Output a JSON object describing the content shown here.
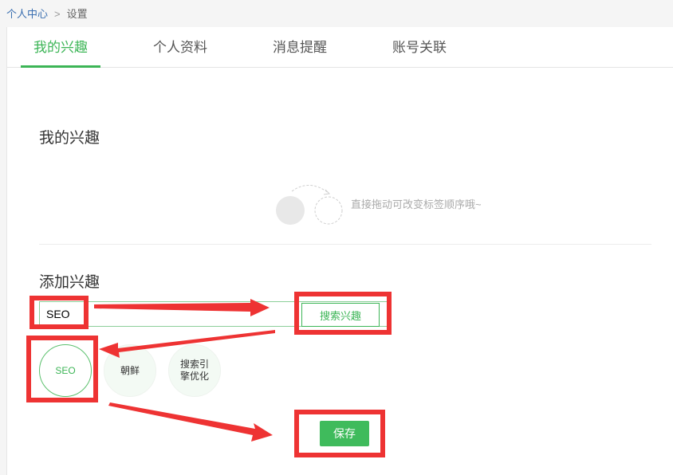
{
  "breadcrumb": {
    "home": "个人中心",
    "separator": ">",
    "current": "设置"
  },
  "tabs": [
    {
      "label": "我的兴趣",
      "active": true
    },
    {
      "label": "个人资料",
      "active": false
    },
    {
      "label": "消息提醒",
      "active": false
    },
    {
      "label": "账号关联",
      "active": false
    }
  ],
  "my_interests": {
    "title": "我的兴趣",
    "hint": "直接拖动可改变标签顺序哦~"
  },
  "add_interest": {
    "title": "添加兴趣",
    "search_value": "SEO",
    "search_button": "搜索兴趣",
    "tags": [
      {
        "label": "SEO",
        "selected": true
      },
      {
        "label": "朝鲜",
        "selected": false
      },
      {
        "label": "搜索引擎优化",
        "selected": false
      }
    ],
    "save_button": "保存"
  },
  "colors": {
    "accent": "#3cb556",
    "annotation_red": "#ee3333"
  }
}
